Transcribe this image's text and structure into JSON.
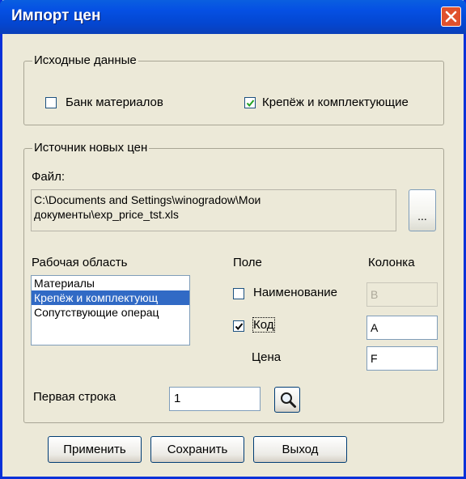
{
  "window": {
    "title": "Импорт цен",
    "close_icon": "close-icon"
  },
  "source_data": {
    "legend": "Исходные данные",
    "bank_materials": {
      "label": "Банк материалов",
      "checked": false
    },
    "fasteners": {
      "label": "Крепёж и комплектующие",
      "checked": true
    }
  },
  "new_prices_source": {
    "legend": "Источник новых цен",
    "file_label": "Файл:",
    "file_path_line1": "C:\\Documents and Settings\\winogradow\\Мои",
    "file_path_line2": "документы\\exp_price_tst.xls",
    "browse_label": "..."
  },
  "work_area": {
    "label": "Рабочая область",
    "items": [
      {
        "label": "Материалы",
        "selected": false
      },
      {
        "label": "Крепёж и комплектующ",
        "selected": true
      },
      {
        "label": "Сопутствующие операц",
        "selected": false
      }
    ]
  },
  "fields": {
    "header_field": "Поле",
    "header_column": "Колонка",
    "name": {
      "label": "Наименование",
      "checked": false,
      "column": "B",
      "enabled": false
    },
    "code": {
      "label": "Код",
      "checked": true,
      "column": "A",
      "enabled": true
    },
    "price": {
      "label": "Цена",
      "column": "F"
    }
  },
  "first_row": {
    "label": "Первая строка",
    "value": "1",
    "icon": "magnifier-icon"
  },
  "buttons": {
    "apply": "Применить",
    "save": "Сохранить",
    "exit": "Выход"
  },
  "colors": {
    "title_bar": "#0550e3",
    "selection": "#316ac5",
    "dialog_bg": "#ece9d8",
    "close_button": "#e0512e"
  }
}
